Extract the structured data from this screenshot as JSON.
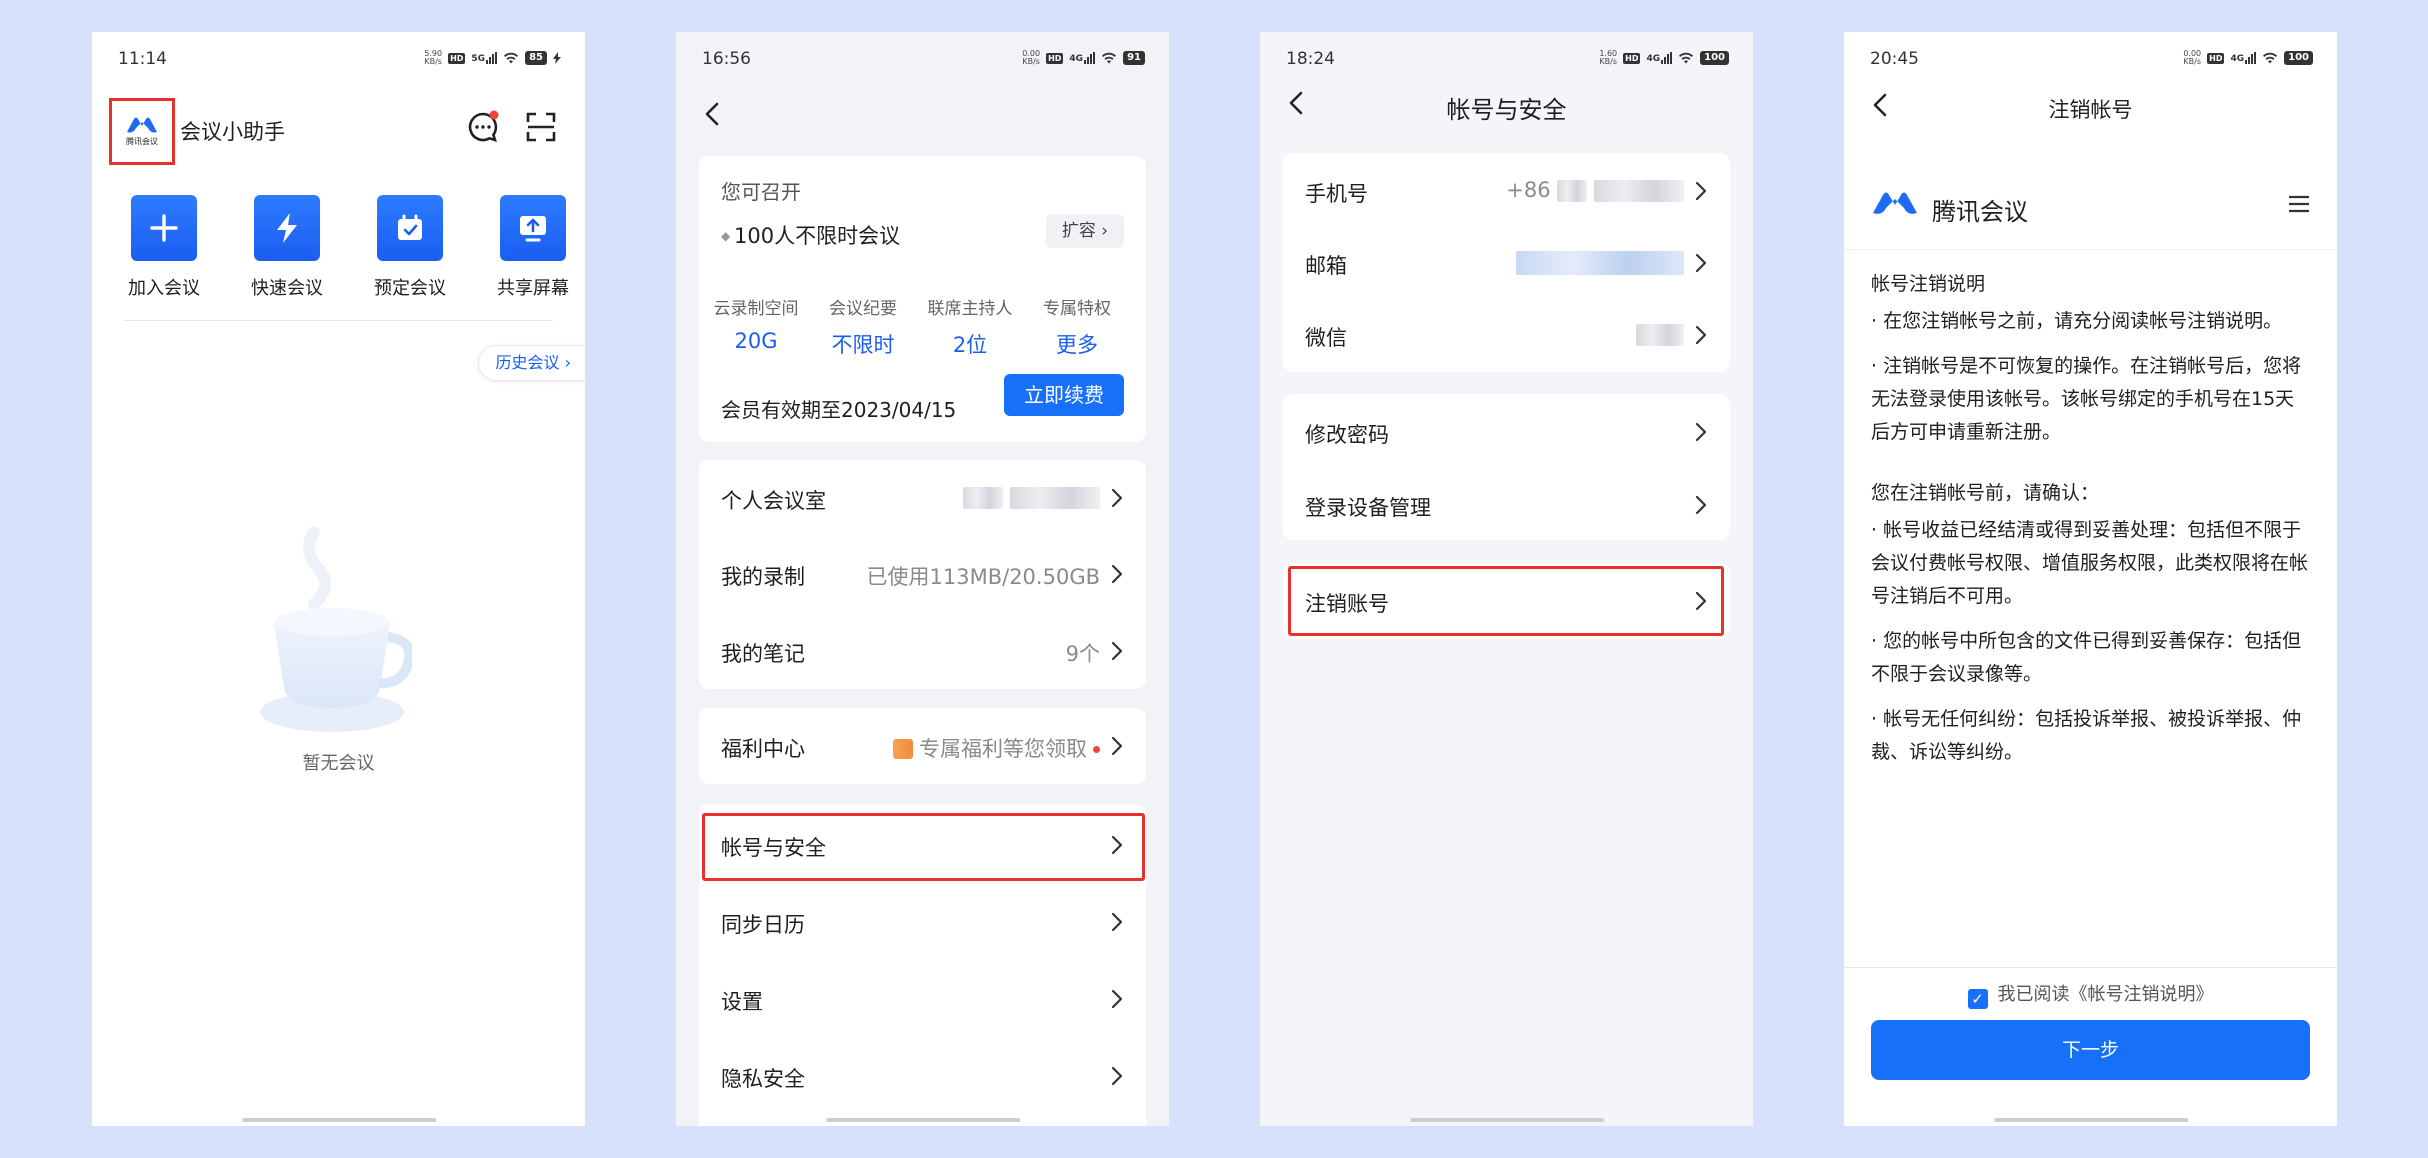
{
  "phone1": {
    "time": "11:14",
    "net": "5.90\nKB/s",
    "battery": "85",
    "logo_text": "腾讯会议",
    "app_title": "会议小助手",
    "actions": [
      "加入会议",
      "快速会议",
      "预定会议",
      "共享屏幕"
    ],
    "history_label": "历史会议",
    "empty_label": "暂无会议"
  },
  "phone2": {
    "time": "16:56",
    "battery": "91",
    "card_title": "您可召开",
    "plan": "100人不限时会议",
    "expand_label": "扩容",
    "features": [
      {
        "label": "云录制空间",
        "value": "20G"
      },
      {
        "label": "会议纪要",
        "value": "不限时"
      },
      {
        "label": "联席主持人",
        "value": "2位"
      },
      {
        "label": "专属特权",
        "value": "更多"
      }
    ],
    "expiry": "会员有效期至2023/04/15",
    "renew_label": "立即续费",
    "rows": [
      {
        "label": "个人会议室",
        "value": ""
      },
      {
        "label": "我的录制",
        "value": "已使用113MB/20.50GB"
      },
      {
        "label": "我的笔记",
        "value": "9个"
      },
      {
        "label": "福利中心",
        "value": "专属福利等您领取"
      },
      {
        "label": "帐号与安全",
        "value": ""
      },
      {
        "label": "同步日历",
        "value": ""
      },
      {
        "label": "设置",
        "value": ""
      },
      {
        "label": "隐私安全",
        "value": ""
      }
    ]
  },
  "phone3": {
    "time": "18:24",
    "battery": "100",
    "title": "帐号与安全",
    "rows": [
      {
        "label": "手机号",
        "value": "+86"
      },
      {
        "label": "邮箱",
        "value": ""
      },
      {
        "label": "微信",
        "value": ""
      },
      {
        "label": "修改密码",
        "value": ""
      },
      {
        "label": "登录设备管理",
        "value": ""
      },
      {
        "label": "注销账号",
        "value": ""
      }
    ]
  },
  "phone4": {
    "time": "20:45",
    "battery": "100",
    "title": "注销帐号",
    "brand": "腾讯会议",
    "heading": "帐号注销说明",
    "p1": "· 在您注销帐号之前，请充分阅读帐号注销说明。",
    "p2": "· 注销帐号是不可恢复的操作。在注销帐号后，您将无法登录使用该帐号。该帐号绑定的手机号在15天后方可申请重新注册。",
    "confirm_heading": "您在注销帐号前，请确认：",
    "c1": "· 帐号收益已经结清或得到妥善处理：包括但不限于会议付费帐号权限、增值服务权限，此类权限将在帐号注销后不可用。",
    "c2": "· 您的帐号中所包含的文件已得到妥善保存：包括但不限于会议录像等。",
    "c3": "· 帐号无任何纠纷：包括投诉举报、被投诉举报、仲裁、诉讼等纠纷。",
    "agree_label": "我已阅读《帐号注销说明》",
    "next_label": "下一步"
  },
  "colors": {
    "page_bg": "#d6e1fb",
    "accent": "#1670f8",
    "highlight": "#e8302c"
  }
}
